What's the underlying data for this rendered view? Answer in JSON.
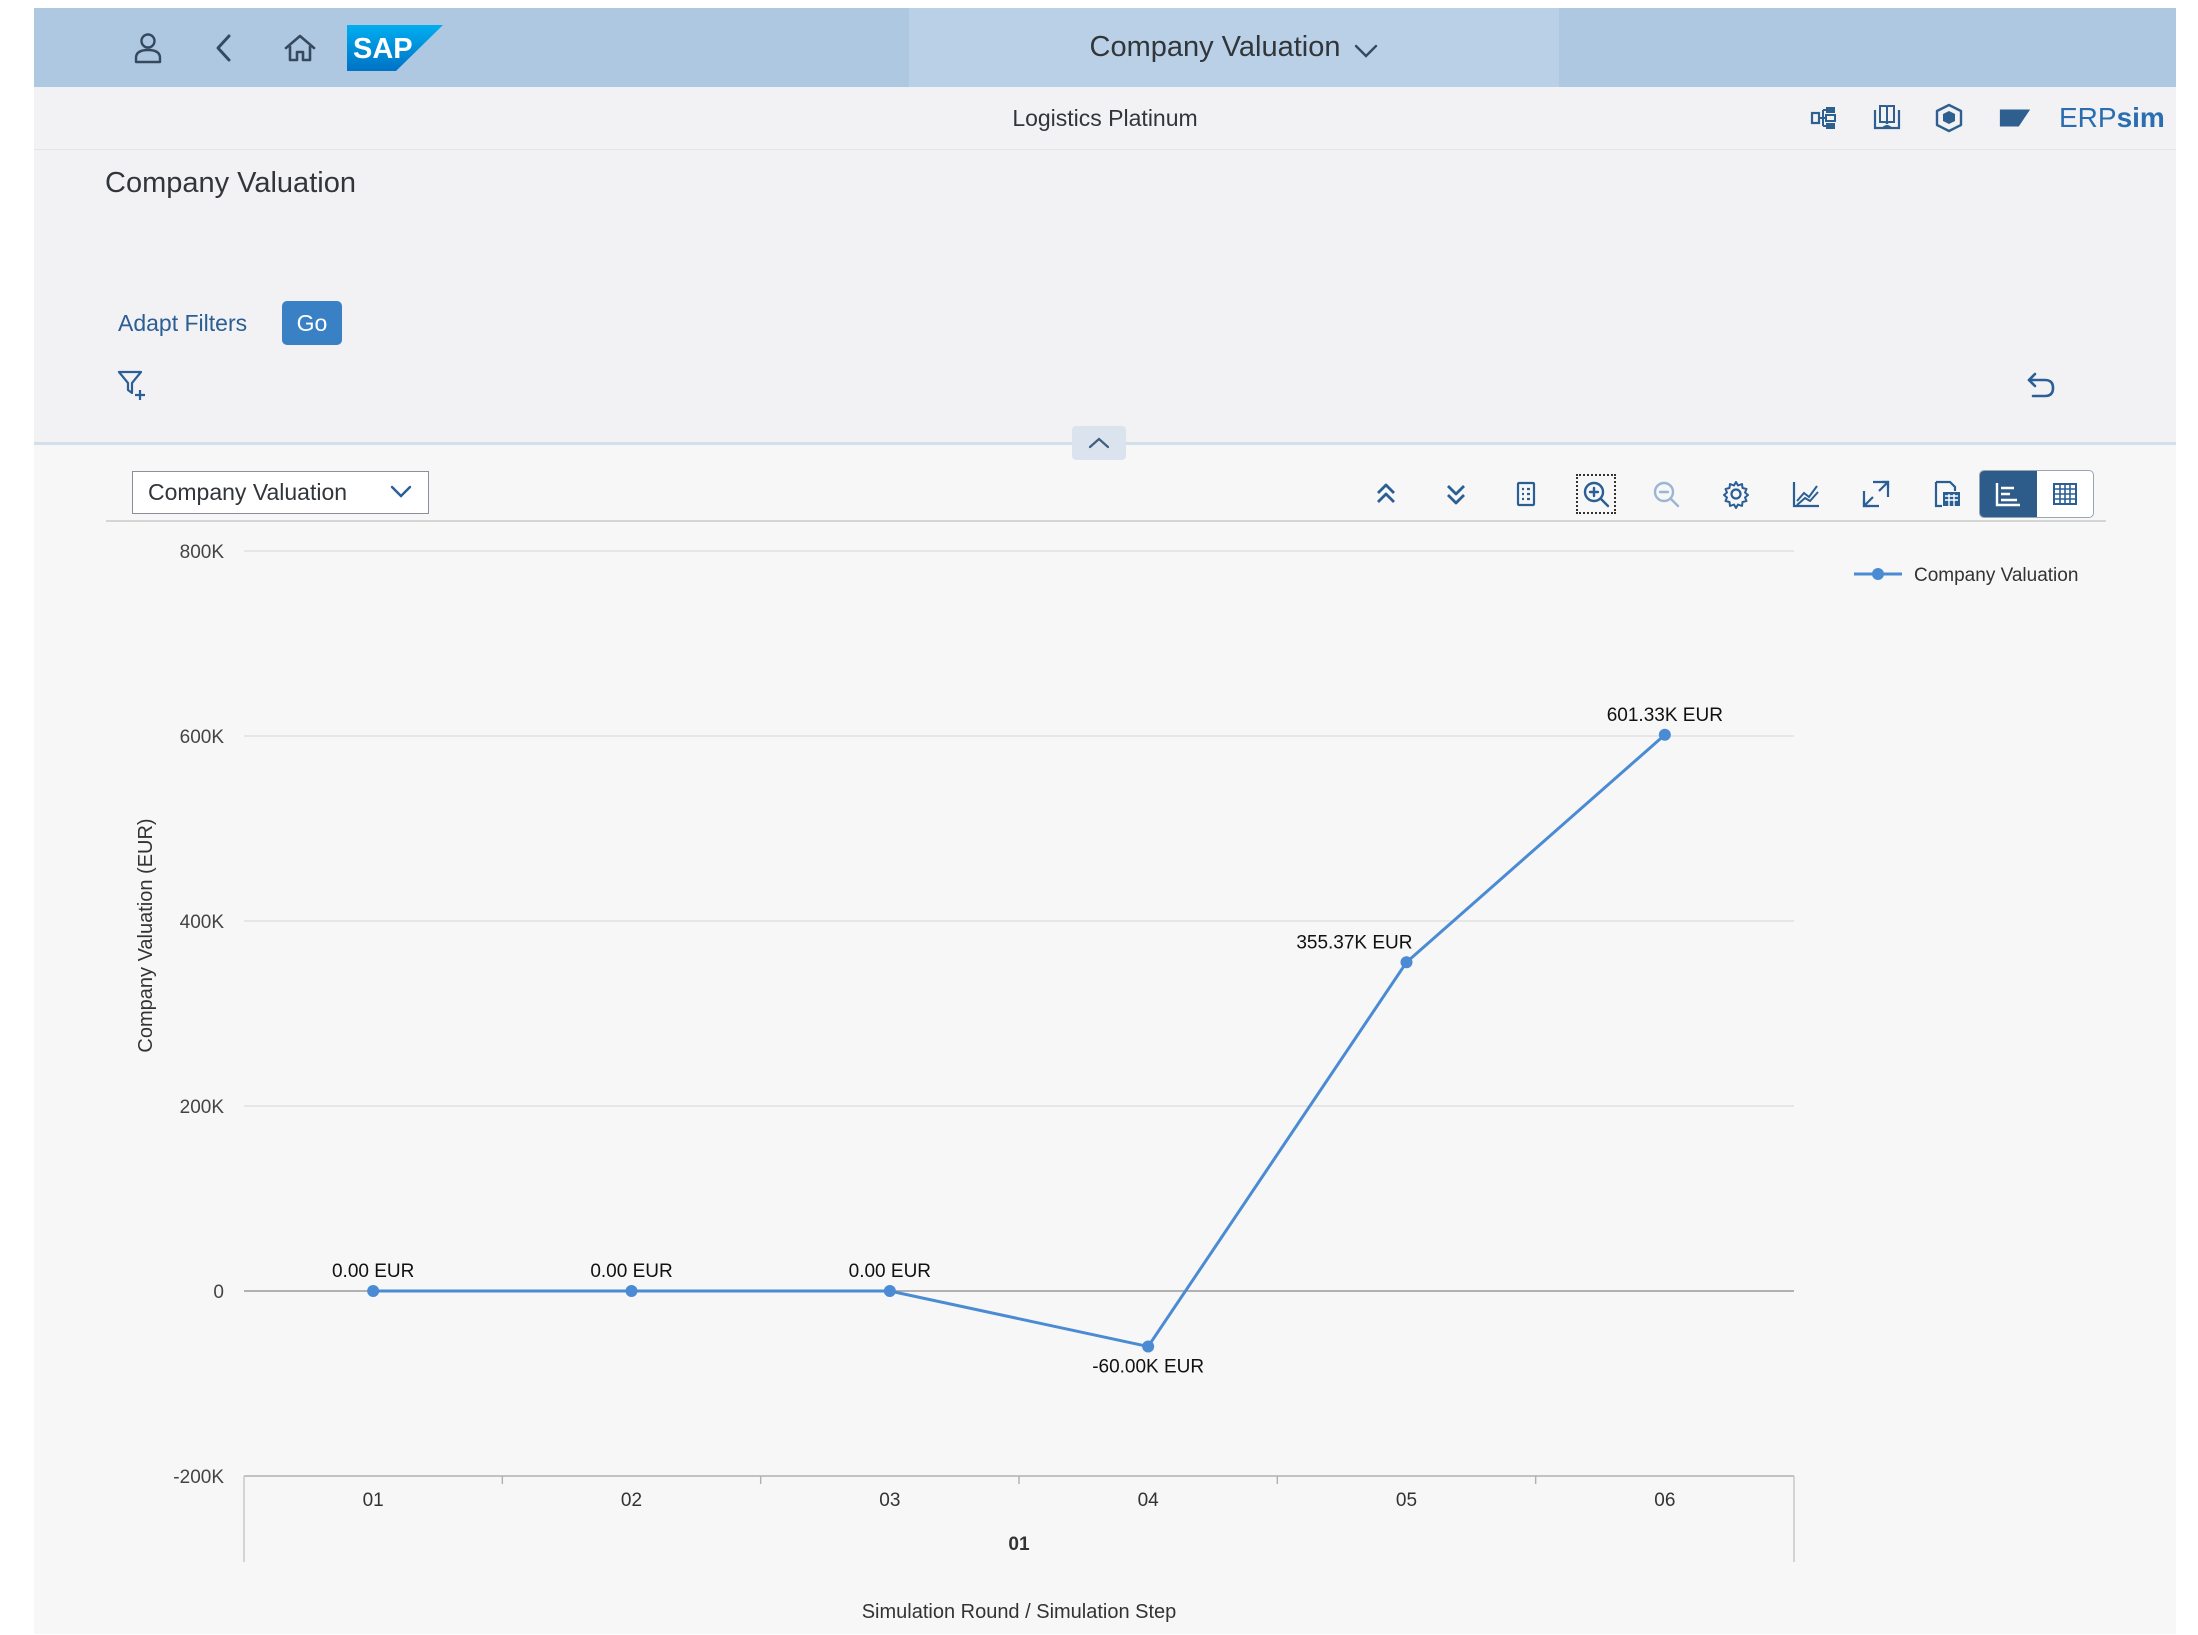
{
  "shell": {
    "app_title": "Company Valuation",
    "logo_text": "SAP"
  },
  "subheader": {
    "title": "Logistics Platinum",
    "brand_prefix": "ERP",
    "brand_suffix": "sim"
  },
  "page": {
    "title": "Company Valuation",
    "adapt_filters": "Adapt Filters",
    "go": "Go"
  },
  "chart_toolbar": {
    "variant": "Company Valuation",
    "buttons": [
      "drill-up-icon",
      "drill-down-icon",
      "details-icon",
      "zoom-in-icon",
      "zoom-out-icon",
      "settings-icon",
      "chart-type-icon",
      "fullscreen-icon",
      "export-icon"
    ],
    "view_toggle": [
      "chart-view-icon",
      "table-view-icon"
    ],
    "selected_view": "chart"
  },
  "colors": {
    "series": "#4a8bd4",
    "shell": "#afc8e1",
    "go": "#3a80c4",
    "brand": "#2a6db1"
  },
  "chart_data": {
    "type": "line",
    "x": [
      "01",
      "02",
      "03",
      "04",
      "05",
      "06"
    ],
    "x_group_label": "01",
    "series": [
      {
        "name": "Company Valuation",
        "values": [
          0,
          0,
          0,
          -60000,
          355370,
          601330
        ]
      }
    ],
    "data_labels": [
      "0.00 EUR",
      "0.00 EUR",
      "0.00 EUR",
      "-60.00K EUR",
      "355.37K EUR",
      "601.33K EUR"
    ],
    "xlabel": "Simulation Round / Simulation Step",
    "ylabel": "Company Valuation (EUR)",
    "ylim": [
      -200000,
      800000
    ],
    "yticks": [
      -200000,
      0,
      200000,
      400000,
      600000,
      800000
    ],
    "ytick_labels": [
      "-200K",
      "0",
      "200K",
      "400K",
      "600K",
      "800K"
    ],
    "grid": true,
    "legend": "top-right"
  }
}
